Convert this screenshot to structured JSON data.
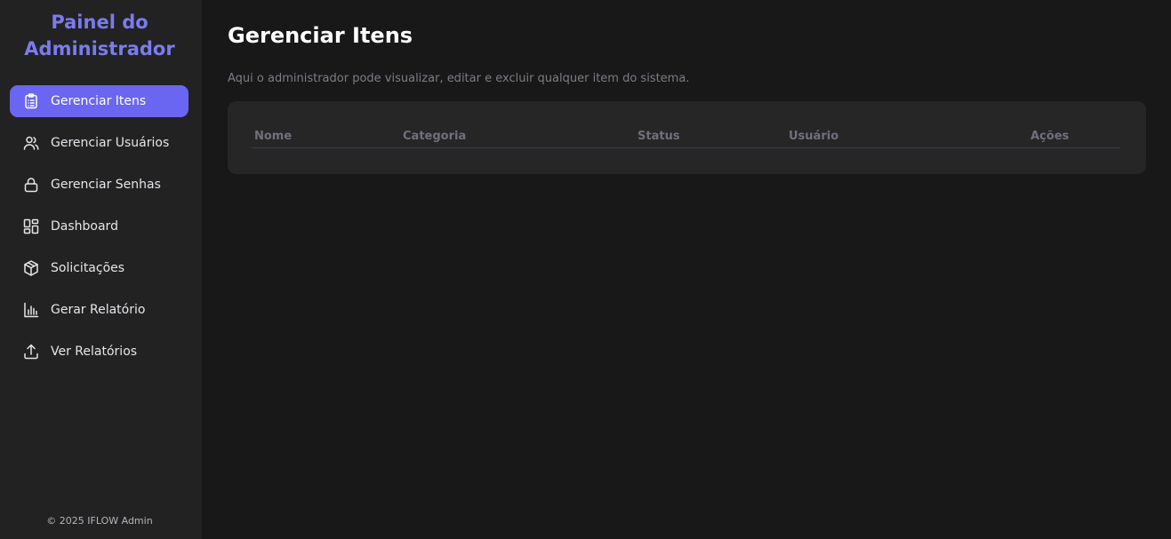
{
  "sidebar": {
    "brand": "Painel do Administrador",
    "items": [
      {
        "label": "Gerenciar Itens",
        "icon": "clipboard-icon",
        "active": true
      },
      {
        "label": "Gerenciar Usuários",
        "icon": "users-icon",
        "active": false
      },
      {
        "label": "Gerenciar Senhas",
        "icon": "lock-icon",
        "active": false
      },
      {
        "label": "Dashboard",
        "icon": "dashboard-grid-icon",
        "active": false
      },
      {
        "label": "Solicitações",
        "icon": "box-icon",
        "active": false
      },
      {
        "label": "Gerar Relatório",
        "icon": "bar-chart-icon",
        "active": false
      },
      {
        "label": "Ver Relatórios",
        "icon": "upload-icon",
        "active": false
      }
    ],
    "footer": "© 2025 IFLOW Admin"
  },
  "main": {
    "title": "Gerenciar Itens",
    "description": "Aqui o administrador pode visualizar, editar e excluir qualquer item do sistema.",
    "table": {
      "columns": [
        "Nome",
        "Categoria",
        "Status",
        "Usuário",
        "Ações"
      ],
      "rows": []
    }
  },
  "colors": {
    "accent": "#6a66f1",
    "brand": "#7b7bf0",
    "sidebar_bg": "#222223",
    "page_bg": "#181818",
    "card_bg": "#262627"
  }
}
